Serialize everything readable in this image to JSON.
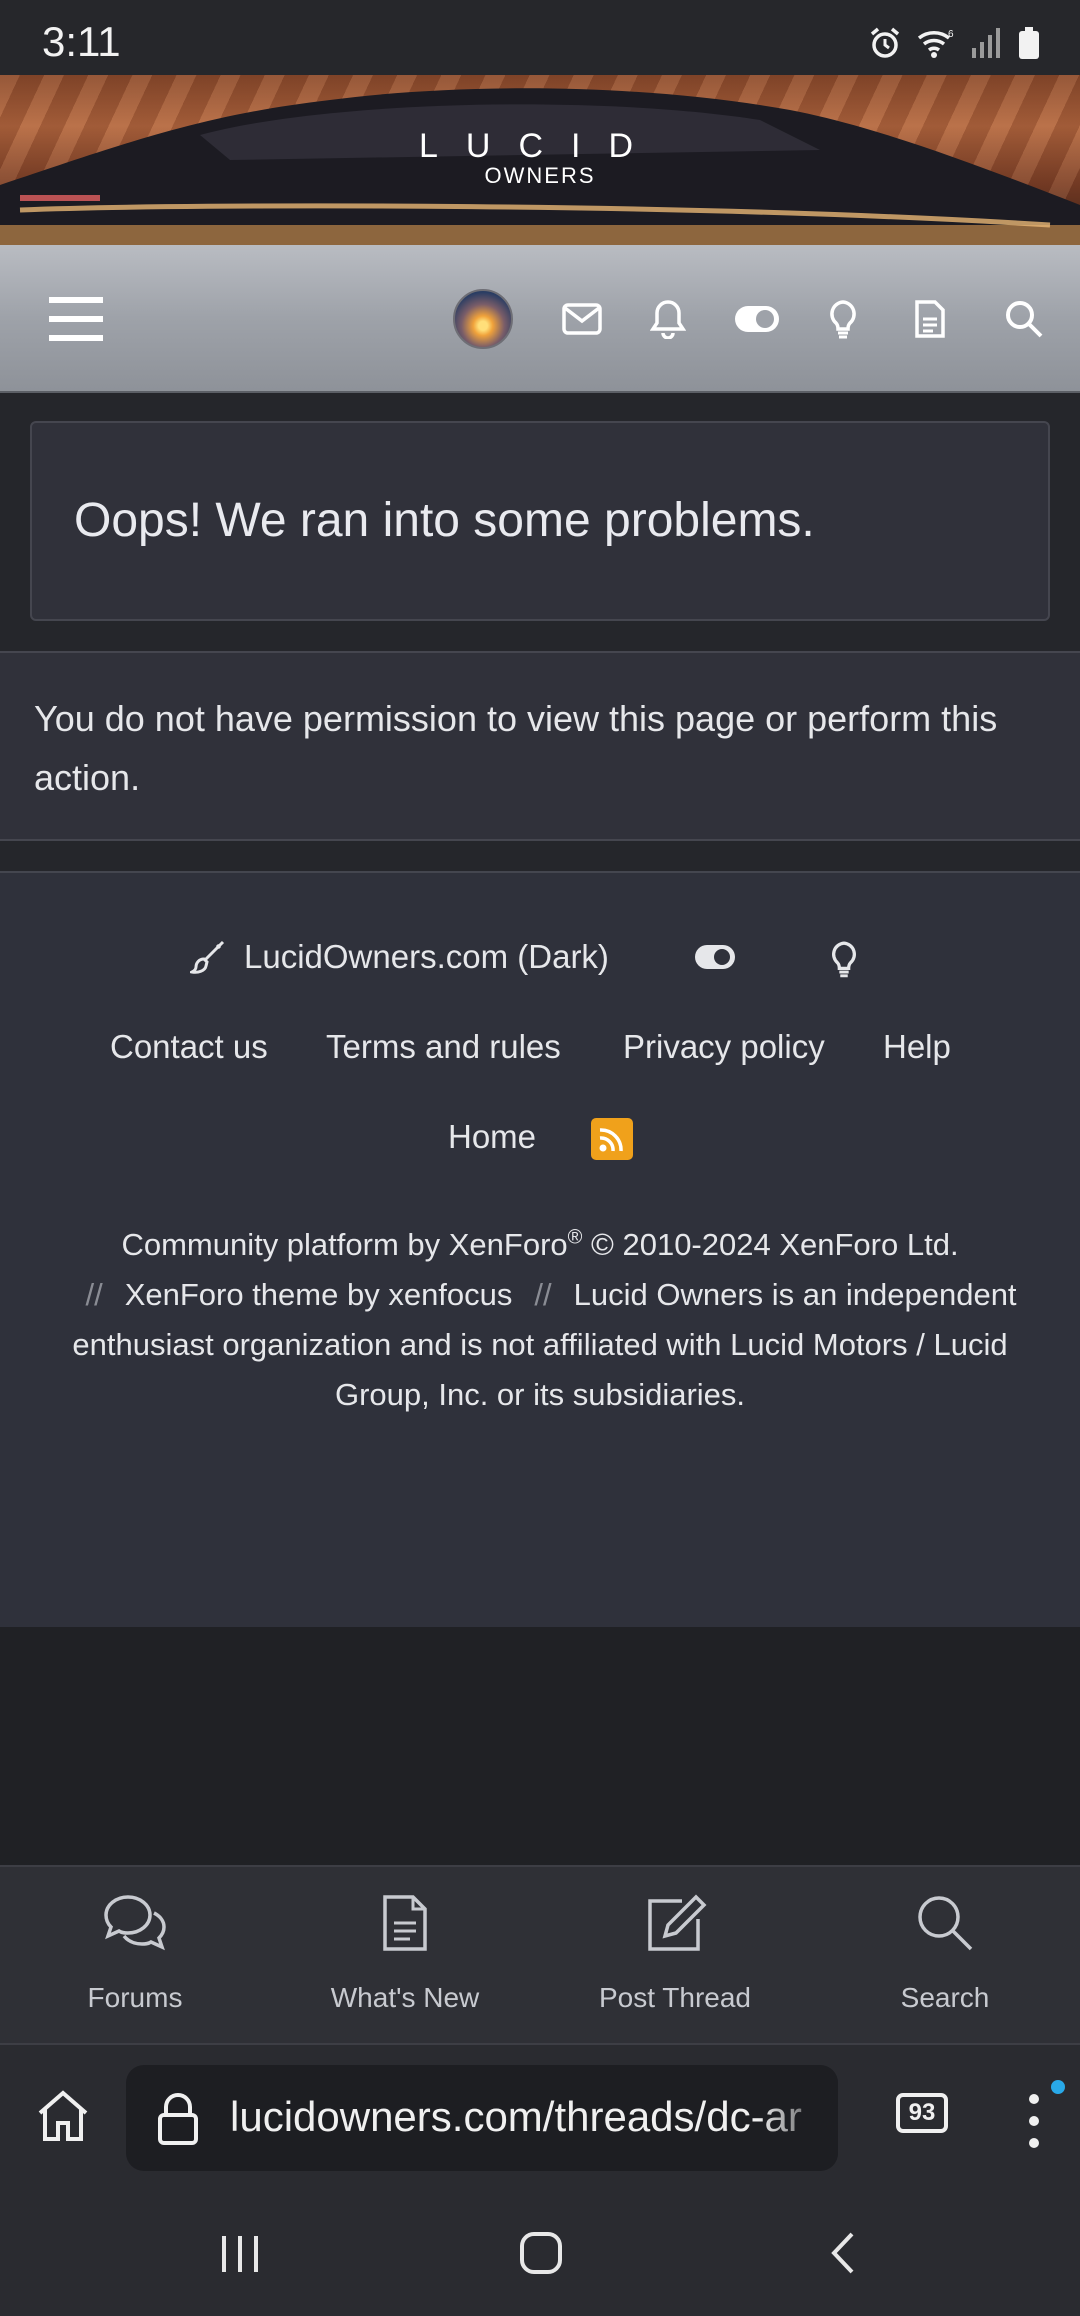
{
  "status_bar": {
    "time": "3:11"
  },
  "banner": {
    "logo_word": "LUCID",
    "logo_sub": "OWNERS"
  },
  "navbar": {
    "icons": [
      "menu-icon",
      "avatar",
      "mail-icon",
      "bell-icon",
      "toggle-icon",
      "bulb-icon",
      "document-icon",
      "search-icon"
    ]
  },
  "error": {
    "title": "Oops! We ran into some problems.",
    "message": "You do not have permission to view this page or perform this action."
  },
  "footer": {
    "style_label": "LucidOwners.com (Dark)",
    "links": [
      "Contact us",
      "Terms and rules",
      "Privacy policy",
      "Help"
    ],
    "home": "Home",
    "copyright_part1": "Community platform by XenForo",
    "registered": "®",
    "copyright_part2": " © 2010-2024 XenForo Ltd.",
    "separator": "//",
    "theme_credit": "XenForo theme by xenfocus",
    "disclaimer": "Lucid Owners is an independent enthusiast organization and is not affiliated with Lucid Motors / Lucid Group, Inc. or its subsidiaries."
  },
  "bottom_nav": {
    "items": [
      {
        "label": "Forums",
        "icon": "chat-bubbles-icon"
      },
      {
        "label": "What's New",
        "icon": "document-icon"
      },
      {
        "label": "Post Thread",
        "icon": "edit-icon"
      },
      {
        "label": "Search",
        "icon": "search-icon"
      }
    ]
  },
  "browser": {
    "url": "lucidowners.com/threads/dc-ar",
    "tab_count": "93"
  },
  "colors": {
    "accent_rss": "#f0a11b",
    "notification_dot": "#29a9e8",
    "page_bg": "#2f313b"
  }
}
